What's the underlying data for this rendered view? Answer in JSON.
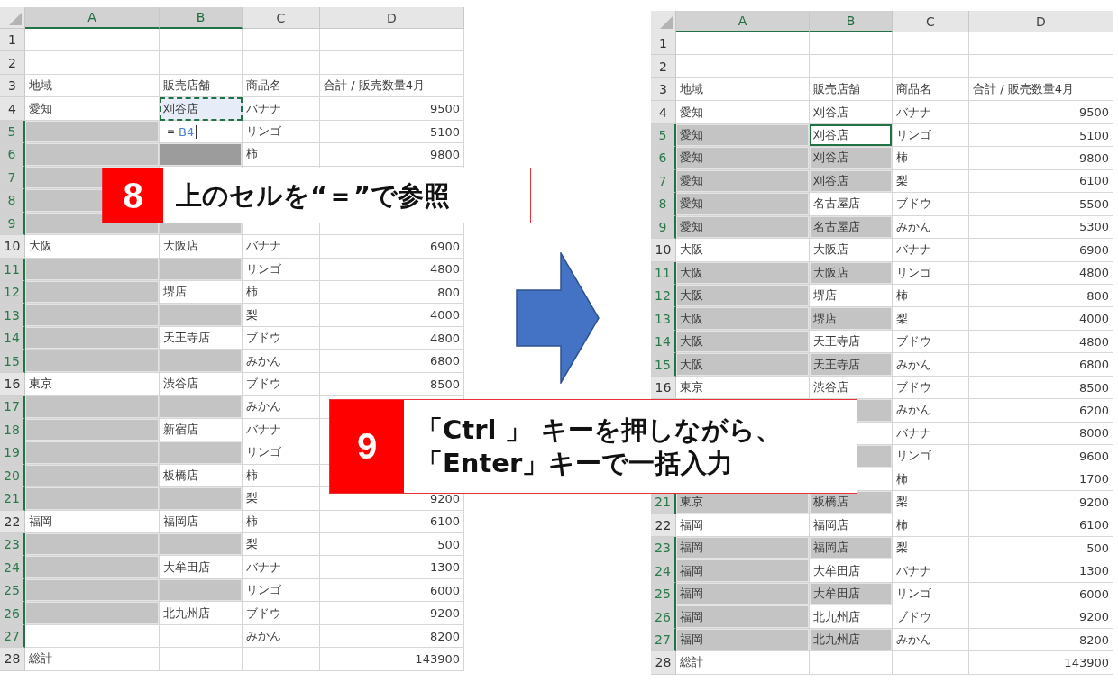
{
  "sheets": [
    {
      "columns": [
        {
          "label": "A",
          "highlighted": true
        },
        {
          "label": "B",
          "highlighted": true
        },
        {
          "label": "C",
          "highlighted": false
        },
        {
          "label": "D",
          "highlighted": false
        }
      ],
      "rows": [
        {
          "number": "1",
          "highlighted": false,
          "cells": [
            {
              "kind": "text",
              "selected": false
            },
            {
              "kind": "text",
              "selected": false
            },
            {
              "kind": "text",
              "selected": false
            },
            {
              "kind": "number",
              "selected": false
            }
          ]
        },
        {
          "number": "2",
          "highlighted": false,
          "cells": [
            {
              "kind": "text",
              "selected": false
            },
            {
              "kind": "text",
              "selected": false
            },
            {
              "kind": "text",
              "selected": false
            },
            {
              "kind": "number",
              "selected": false
            }
          ]
        },
        {
          "number": "3",
          "highlighted": false,
          "cells": [
            {
              "kind": "text",
              "text": "地域",
              "selected": false
            },
            {
              "kind": "text",
              "text": "販売店舗",
              "selected": false
            },
            {
              "kind": "text",
              "text": "商品名",
              "selected": false
            },
            {
              "kind": "text",
              "text": "合計 / 販売数量4月",
              "selected": false
            }
          ]
        },
        {
          "number": "4",
          "highlighted": false,
          "cells": [
            {
              "kind": "text",
              "text": "愛知",
              "selected": false
            },
            {
              "kind": "copy-source",
              "text": "刈谷店",
              "selected": false
            },
            {
              "kind": "text",
              "text": "バナナ",
              "selected": false
            },
            {
              "kind": "number",
              "text": "9500",
              "selected": false
            }
          ]
        },
        {
          "number": "5",
          "highlighted": true,
          "cells": [
            {
              "kind": "text",
              "selected": true
            },
            {
              "kind": "formula",
              "operator": "＝",
              "reference": "B4",
              "selected": false
            },
            {
              "kind": "text",
              "text": "リンゴ",
              "selected": false
            },
            {
              "kind": "number",
              "text": "5100",
              "selected": false
            }
          ]
        },
        {
          "number": "6",
          "highlighted": true,
          "cells": [
            {
              "kind": "text",
              "selected": true
            },
            {
              "kind": "current",
              "selected": true
            },
            {
              "kind": "text",
              "text": "柿",
              "selected": false
            },
            {
              "kind": "number",
              "text": "9800",
              "selected": false
            }
          ]
        },
        {
          "number": "7",
          "highlighted": true,
          "cells": [
            {
              "kind": "text",
              "selected": true
            },
            {
              "kind": "hidden"
            },
            {
              "kind": "hidden"
            },
            {
              "kind": "hidden"
            }
          ]
        },
        {
          "number": "8",
          "highlighted": true,
          "cells": [
            {
              "kind": "text",
              "selected": true
            },
            {
              "kind": "hidden"
            },
            {
              "kind": "hidden"
            },
            {
              "kind": "hidden"
            }
          ]
        },
        {
          "number": "9",
          "highlighted": true,
          "cells": [
            {
              "kind": "text",
              "selected": true
            },
            {
              "kind": "text",
              "selected": true
            },
            {
              "kind": "text",
              "selected": false
            },
            {
              "kind": "number",
              "selected": false
            }
          ]
        },
        {
          "number": "10",
          "highlighted": false,
          "cells": [
            {
              "kind": "text",
              "text": "大阪",
              "selected": false
            },
            {
              "kind": "text",
              "text": "大阪店",
              "selected": false
            },
            {
              "kind": "text",
              "text": "バナナ",
              "selected": false
            },
            {
              "kind": "number",
              "text": "6900",
              "selected": false
            }
          ]
        },
        {
          "number": "11",
          "highlighted": true,
          "cells": [
            {
              "kind": "text",
              "selected": true
            },
            {
              "kind": "text",
              "selected": true
            },
            {
              "kind": "text",
              "text": "リンゴ",
              "selected": false
            },
            {
              "kind": "number",
              "text": "4800",
              "selected": false
            }
          ]
        },
        {
          "number": "12",
          "highlighted": true,
          "cells": [
            {
              "kind": "text",
              "selected": true
            },
            {
              "kind": "text",
              "text": "堺店",
              "selected": false
            },
            {
              "kind": "text",
              "text": "柿",
              "selected": false
            },
            {
              "kind": "number",
              "text": "800",
              "selected": false
            }
          ]
        },
        {
          "number": "13",
          "highlighted": true,
          "cells": [
            {
              "kind": "text",
              "selected": true
            },
            {
              "kind": "text",
              "selected": true
            },
            {
              "kind": "text",
              "text": "梨",
              "selected": false
            },
            {
              "kind": "number",
              "text": "4000",
              "selected": false
            }
          ]
        },
        {
          "number": "14",
          "highlighted": true,
          "cells": [
            {
              "kind": "text",
              "selected": true
            },
            {
              "kind": "text",
              "text": "天王寺店",
              "selected": false
            },
            {
              "kind": "text",
              "text": "ブドウ",
              "selected": false
            },
            {
              "kind": "number",
              "text": "4800",
              "selected": false
            }
          ]
        },
        {
          "number": "15",
          "highlighted": true,
          "cells": [
            {
              "kind": "text",
              "selected": true
            },
            {
              "kind": "text",
              "selected": true
            },
            {
              "kind": "text",
              "text": "みかん",
              "selected": false
            },
            {
              "kind": "number",
              "text": "6800",
              "selected": false
            }
          ]
        },
        {
          "number": "16",
          "highlighted": false,
          "cells": [
            {
              "kind": "text",
              "text": "東京",
              "selected": false
            },
            {
              "kind": "text",
              "text": "渋谷店",
              "selected": false
            },
            {
              "kind": "text",
              "text": "ブドウ",
              "selected": false
            },
            {
              "kind": "number",
              "text": "8500",
              "selected": false
            }
          ]
        },
        {
          "number": "17",
          "highlighted": true,
          "cells": [
            {
              "kind": "text",
              "selected": true
            },
            {
              "kind": "text",
              "selected": true
            },
            {
              "kind": "text",
              "text": "みかん",
              "selected": false
            },
            {
              "kind": "hidden"
            }
          ]
        },
        {
          "number": "18",
          "highlighted": true,
          "cells": [
            {
              "kind": "text",
              "selected": true
            },
            {
              "kind": "text",
              "text": "新宿店",
              "selected": false
            },
            {
              "kind": "text",
              "text": "バナナ",
              "selected": false
            },
            {
              "kind": "hidden"
            }
          ]
        },
        {
          "number": "19",
          "highlighted": true,
          "cells": [
            {
              "kind": "text",
              "selected": true
            },
            {
              "kind": "text",
              "selected": true
            },
            {
              "kind": "text",
              "text": "リンゴ",
              "selected": false
            },
            {
              "kind": "hidden"
            }
          ]
        },
        {
          "number": "20",
          "highlighted": true,
          "cells": [
            {
              "kind": "text",
              "selected": true
            },
            {
              "kind": "text",
              "text": "板橋店",
              "selected": false
            },
            {
              "kind": "text",
              "text": "柿",
              "selected": false
            },
            {
              "kind": "hidden"
            }
          ]
        },
        {
          "number": "21",
          "highlighted": true,
          "cells": [
            {
              "kind": "text",
              "selected": true
            },
            {
              "kind": "text",
              "selected": true
            },
            {
              "kind": "text",
              "text": "梨",
              "selected": false
            },
            {
              "kind": "number",
              "text": "9200",
              "selected": false
            }
          ]
        },
        {
          "number": "22",
          "highlighted": false,
          "cells": [
            {
              "kind": "text",
              "text": "福岡",
              "selected": false
            },
            {
              "kind": "text",
              "text": "福岡店",
              "selected": false
            },
            {
              "kind": "text",
              "text": "柿",
              "selected": false
            },
            {
              "kind": "number",
              "text": "6100",
              "selected": false
            }
          ]
        },
        {
          "number": "23",
          "highlighted": true,
          "cells": [
            {
              "kind": "text",
              "selected": true
            },
            {
              "kind": "text",
              "selected": true
            },
            {
              "kind": "text",
              "text": "梨",
              "selected": false
            },
            {
              "kind": "number",
              "text": "500",
              "selected": false
            }
          ]
        },
        {
          "number": "24",
          "highlighted": true,
          "cells": [
            {
              "kind": "text",
              "selected": true
            },
            {
              "kind": "text",
              "text": "大牟田店",
              "selected": false
            },
            {
              "kind": "text",
              "text": "バナナ",
              "selected": false
            },
            {
              "kind": "number",
              "text": "1300",
              "selected": false
            }
          ]
        },
        {
          "number": "25",
          "highlighted": true,
          "cells": [
            {
              "kind": "text",
              "selected": true
            },
            {
              "kind": "text",
              "selected": true
            },
            {
              "kind": "text",
              "text": "リンゴ",
              "selected": false
            },
            {
              "kind": "number",
              "text": "6000",
              "selected": false
            }
          ]
        },
        {
          "number": "26",
          "highlighted": true,
          "cells": [
            {
              "kind": "text",
              "selected": true
            },
            {
              "kind": "text",
              "text": "北九州店",
              "selected": false
            },
            {
              "kind": "text",
              "text": "ブドウ",
              "selected": false
            },
            {
              "kind": "number",
              "text": "9200",
              "selected": false
            }
          ]
        },
        {
          "number": "27",
          "highlighted": true,
          "cells": [
            {
              "kind": "text",
              "selected": false
            },
            {
              "kind": "text",
              "selected": false
            },
            {
              "kind": "text",
              "text": "みかん",
              "selected": false
            },
            {
              "kind": "number",
              "text": "8200",
              "selected": false
            }
          ]
        },
        {
          "number": "28",
          "highlighted": false,
          "cells": [
            {
              "kind": "text",
              "text": "総計",
              "selected": false
            },
            {
              "kind": "text",
              "selected": false
            },
            {
              "kind": "text",
              "selected": false
            },
            {
              "kind": "number",
              "text": "143900",
              "selected": false
            }
          ]
        }
      ]
    },
    {
      "columns": [
        {
          "label": "A",
          "highlighted": true
        },
        {
          "label": "B",
          "highlighted": true
        },
        {
          "label": "C",
          "highlighted": false
        },
        {
          "label": "D",
          "highlighted": false
        }
      ],
      "rows": [
        {
          "number": "1",
          "highlighted": false,
          "cells": [
            {
              "kind": "text",
              "selected": false
            },
            {
              "kind": "text",
              "selected": false
            },
            {
              "kind": "text",
              "selected": false
            },
            {
              "kind": "number",
              "selected": false
            }
          ]
        },
        {
          "number": "2",
          "highlighted": false,
          "cells": [
            {
              "kind": "text",
              "selected": false
            },
            {
              "kind": "text",
              "selected": false
            },
            {
              "kind": "text",
              "selected": false
            },
            {
              "kind": "number",
              "selected": false
            }
          ]
        },
        {
          "number": "3",
          "highlighted": false,
          "cells": [
            {
              "kind": "text",
              "text": "地域",
              "selected": false
            },
            {
              "kind": "text",
              "text": "販売店舗",
              "selected": false
            },
            {
              "kind": "text",
              "text": "商品名",
              "selected": false
            },
            {
              "kind": "text",
              "text": "合計 / 販売数量4月",
              "selected": false
            }
          ]
        },
        {
          "number": "4",
          "highlighted": false,
          "cells": [
            {
              "kind": "text",
              "text": "愛知",
              "selected": false
            },
            {
              "kind": "text",
              "text": "刈谷店",
              "selected": false
            },
            {
              "kind": "text",
              "text": "バナナ",
              "selected": false
            },
            {
              "kind": "number",
              "text": "9500",
              "selected": false
            }
          ]
        },
        {
          "number": "5",
          "highlighted": true,
          "cells": [
            {
              "kind": "text",
              "text": "愛知",
              "selected": true
            },
            {
              "kind": "active",
              "text": "刈谷店",
              "selected": false
            },
            {
              "kind": "text",
              "text": "リンゴ",
              "selected": false
            },
            {
              "kind": "number",
              "text": "5100",
              "selected": false
            }
          ]
        },
        {
          "number": "6",
          "highlighted": true,
          "cells": [
            {
              "kind": "text",
              "text": "愛知",
              "selected": true
            },
            {
              "kind": "text",
              "text": "刈谷店",
              "selected": true
            },
            {
              "kind": "text",
              "text": "柿",
              "selected": false
            },
            {
              "kind": "number",
              "text": "9800",
              "selected": false
            }
          ]
        },
        {
          "number": "7",
          "highlighted": true,
          "cells": [
            {
              "kind": "text",
              "text": "愛知",
              "selected": true
            },
            {
              "kind": "text",
              "text": "刈谷店",
              "selected": true
            },
            {
              "kind": "text",
              "text": "梨",
              "selected": false
            },
            {
              "kind": "number",
              "text": "6100",
              "selected": false
            }
          ]
        },
        {
          "number": "8",
          "highlighted": true,
          "cells": [
            {
              "kind": "text",
              "text": "愛知",
              "selected": true
            },
            {
              "kind": "text",
              "text": "名古屋店",
              "selected": false
            },
            {
              "kind": "text",
              "text": "ブドウ",
              "selected": false
            },
            {
              "kind": "number",
              "text": "5500",
              "selected": false
            }
          ]
        },
        {
          "number": "9",
          "highlighted": true,
          "cells": [
            {
              "kind": "text",
              "text": "愛知",
              "selected": true
            },
            {
              "kind": "text",
              "text": "名古屋店",
              "selected": true
            },
            {
              "kind": "text",
              "text": "みかん",
              "selected": false
            },
            {
              "kind": "number",
              "text": "5300",
              "selected": false
            }
          ]
        },
        {
          "number": "10",
          "highlighted": false,
          "cells": [
            {
              "kind": "text",
              "text": "大阪",
              "selected": false
            },
            {
              "kind": "text",
              "text": "大阪店",
              "selected": false
            },
            {
              "kind": "text",
              "text": "バナナ",
              "selected": false
            },
            {
              "kind": "number",
              "text": "6900",
              "selected": false
            }
          ]
        },
        {
          "number": "11",
          "highlighted": true,
          "cells": [
            {
              "kind": "text",
              "text": "大阪",
              "selected": true
            },
            {
              "kind": "text",
              "text": "大阪店",
              "selected": true
            },
            {
              "kind": "text",
              "text": "リンゴ",
              "selected": false
            },
            {
              "kind": "number",
              "text": "4800",
              "selected": false
            }
          ]
        },
        {
          "number": "12",
          "highlighted": true,
          "cells": [
            {
              "kind": "text",
              "text": "大阪",
              "selected": true
            },
            {
              "kind": "text",
              "text": "堺店",
              "selected": false
            },
            {
              "kind": "text",
              "text": "柿",
              "selected": false
            },
            {
              "kind": "number",
              "text": "800",
              "selected": false
            }
          ]
        },
        {
          "number": "13",
          "highlighted": true,
          "cells": [
            {
              "kind": "text",
              "text": "大阪",
              "selected": true
            },
            {
              "kind": "text",
              "text": "堺店",
              "selected": true
            },
            {
              "kind": "text",
              "text": "梨",
              "selected": false
            },
            {
              "kind": "number",
              "text": "4000",
              "selected": false
            }
          ]
        },
        {
          "number": "14",
          "highlighted": true,
          "cells": [
            {
              "kind": "text",
              "text": "大阪",
              "selected": true
            },
            {
              "kind": "text",
              "text": "天王寺店",
              "selected": false
            },
            {
              "kind": "text",
              "text": "ブドウ",
              "selected": false
            },
            {
              "kind": "number",
              "text": "4800",
              "selected": false
            }
          ]
        },
        {
          "number": "15",
          "highlighted": true,
          "cells": [
            {
              "kind": "text",
              "text": "大阪",
              "selected": true
            },
            {
              "kind": "text",
              "text": "天王寺店",
              "selected": true
            },
            {
              "kind": "text",
              "text": "みかん",
              "selected": false
            },
            {
              "kind": "number",
              "text": "6800",
              "selected": false
            }
          ]
        },
        {
          "number": "16",
          "highlighted": false,
          "cells": [
            {
              "kind": "text",
              "text": "東京",
              "selected": false
            },
            {
              "kind": "text",
              "text": "渋谷店",
              "selected": false
            },
            {
              "kind": "text",
              "text": "ブドウ",
              "selected": false
            },
            {
              "kind": "number",
              "text": "8500",
              "selected": false
            }
          ]
        },
        {
          "cells": [
            {
              "kind": "hidden"
            },
            {
              "kind": "text",
              "selected": true
            },
            {
              "kind": "text",
              "text": "みかん",
              "selected": false
            },
            {
              "kind": "number",
              "text": "6200",
              "selected": false
            }
          ]
        },
        {
          "cells": [
            {
              "kind": "hidden"
            },
            {
              "kind": "text",
              "selected": false
            },
            {
              "kind": "text",
              "text": "バナナ",
              "selected": false
            },
            {
              "kind": "number",
              "text": "8000",
              "selected": false
            }
          ]
        },
        {
          "cells": [
            {
              "kind": "hidden"
            },
            {
              "kind": "text",
              "selected": true
            },
            {
              "kind": "text",
              "text": "リンゴ",
              "selected": false
            },
            {
              "kind": "number",
              "text": "9600",
              "selected": false
            }
          ]
        },
        {
          "cells": [
            {
              "kind": "hidden"
            },
            {
              "kind": "text",
              "selected": false
            },
            {
              "kind": "text",
              "text": "柿",
              "selected": false
            },
            {
              "kind": "number",
              "text": "1700",
              "selected": false
            }
          ]
        },
        {
          "number": "21",
          "highlighted": true,
          "cells": [
            {
              "kind": "text",
              "text": "東京",
              "selected": true
            },
            {
              "kind": "text",
              "text": "板橋店",
              "selected": true
            },
            {
              "kind": "text",
              "text": "梨",
              "selected": false
            },
            {
              "kind": "number",
              "text": "9200",
              "selected": false
            }
          ]
        },
        {
          "number": "22",
          "highlighted": false,
          "cells": [
            {
              "kind": "text",
              "text": "福岡",
              "selected": false
            },
            {
              "kind": "text",
              "text": "福岡店",
              "selected": false
            },
            {
              "kind": "text",
              "text": "柿",
              "selected": false
            },
            {
              "kind": "number",
              "text": "6100",
              "selected": false
            }
          ]
        },
        {
          "number": "23",
          "highlighted": true,
          "cells": [
            {
              "kind": "text",
              "text": "福岡",
              "selected": true
            },
            {
              "kind": "text",
              "text": "福岡店",
              "selected": true
            },
            {
              "kind": "text",
              "text": "梨",
              "selected": false
            },
            {
              "kind": "number",
              "text": "500",
              "selected": false
            }
          ]
        },
        {
          "number": "24",
          "highlighted": true,
          "cells": [
            {
              "kind": "text",
              "text": "福岡",
              "selected": true
            },
            {
              "kind": "text",
              "text": "大牟田店",
              "selected": false
            },
            {
              "kind": "text",
              "text": "バナナ",
              "selected": false
            },
            {
              "kind": "number",
              "text": "1300",
              "selected": false
            }
          ]
        },
        {
          "number": "25",
          "highlighted": true,
          "cells": [
            {
              "kind": "text",
              "text": "福岡",
              "selected": true
            },
            {
              "kind": "text",
              "text": "大牟田店",
              "selected": true
            },
            {
              "kind": "text",
              "text": "リンゴ",
              "selected": false
            },
            {
              "kind": "number",
              "text": "6000",
              "selected": false
            }
          ]
        },
        {
          "number": "26",
          "highlighted": true,
          "cells": [
            {
              "kind": "text",
              "text": "福岡",
              "selected": true
            },
            {
              "kind": "text",
              "text": "北九州店",
              "selected": false
            },
            {
              "kind": "text",
              "text": "ブドウ",
              "selected": false
            },
            {
              "kind": "number",
              "text": "9200",
              "selected": false
            }
          ]
        },
        {
          "number": "27",
          "highlighted": true,
          "cells": [
            {
              "kind": "text",
              "text": "福岡",
              "selected": true
            },
            {
              "kind": "text",
              "text": "北九州店",
              "selected": true
            },
            {
              "kind": "text",
              "text": "みかん",
              "selected": false
            },
            {
              "kind": "number",
              "text": "8200",
              "selected": false
            }
          ]
        },
        {
          "number": "28",
          "highlighted": false,
          "cells": [
            {
              "kind": "text",
              "text": "総計",
              "selected": false
            },
            {
              "kind": "text",
              "selected": false
            },
            {
              "kind": "text",
              "selected": false
            },
            {
              "kind": "number",
              "text": "143900",
              "selected": false
            }
          ]
        }
      ]
    }
  ],
  "callouts": [
    {
      "number": "8",
      "lines": [
        "上のセルを“＝”で参照"
      ]
    },
    {
      "number": "9",
      "lines": [
        "「Ctrl 」 キーを押しながら、",
        "「Enter」キーで一括入力"
      ]
    }
  ]
}
